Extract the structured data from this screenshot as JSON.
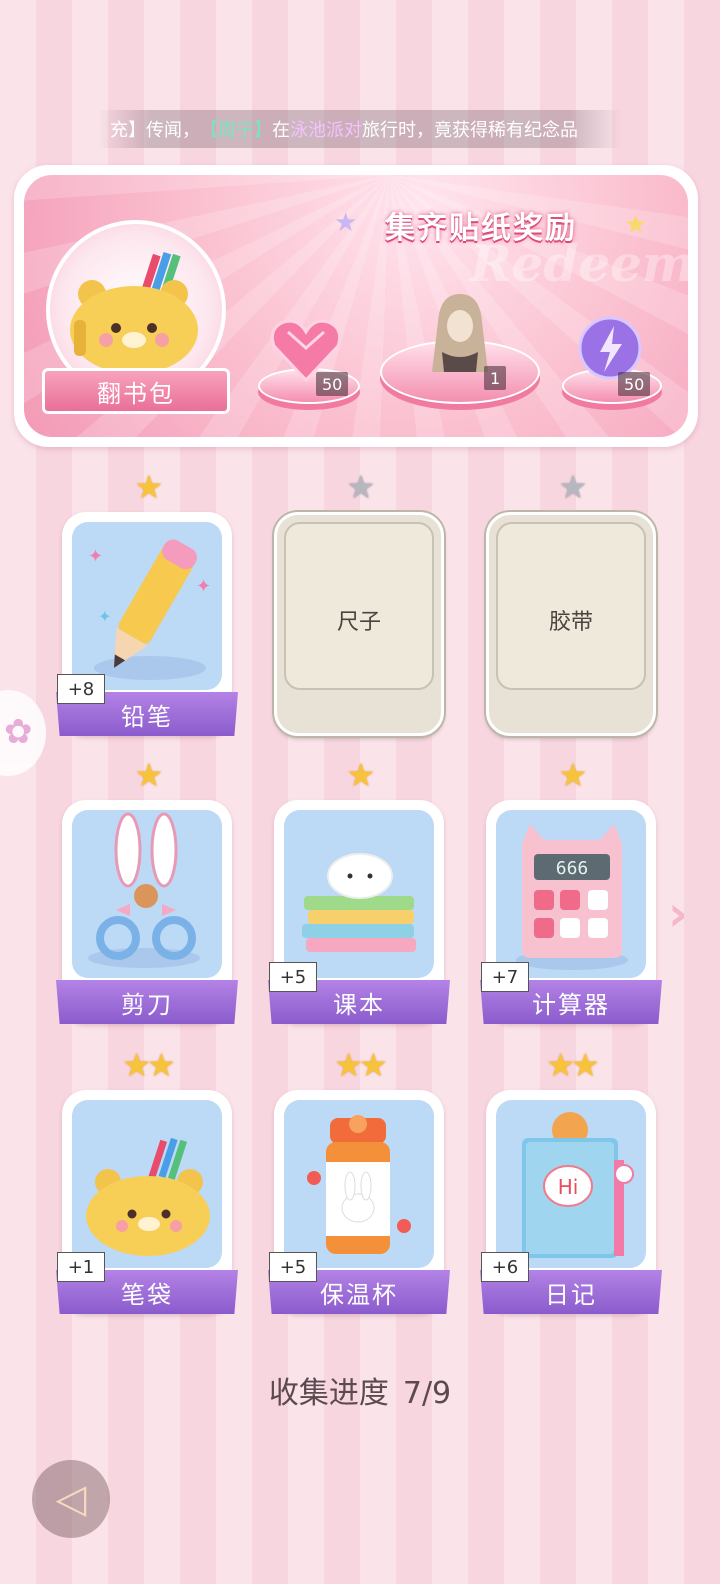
{
  "marquee": {
    "prefix": "充】传闻，",
    "player": "【周宁】",
    "mid": "在",
    "place": "泳池派对",
    "suffix": "旅行时，竟获得稀有纪念品"
  },
  "reward_panel": {
    "title": "集齐贴纸奖励",
    "watermark": "Redeem",
    "bag_label": "翻书包",
    "rewards": [
      {
        "icon": "pink-heart-gem-icon",
        "qty": "50"
      },
      {
        "icon": "doll-outfit-icon",
        "qty": "1"
      },
      {
        "icon": "lightning-orb-icon",
        "qty": "50"
      }
    ]
  },
  "cards": [
    {
      "name": "铅笔",
      "stars": 1,
      "collected": true,
      "bonus": "+8",
      "icon": "pencil-icon"
    },
    {
      "name": "尺子",
      "stars": 1,
      "collected": false,
      "icon": "ruler-icon"
    },
    {
      "name": "胶带",
      "stars": 1,
      "collected": false,
      "icon": "tape-icon"
    },
    {
      "name": "剪刀",
      "stars": 1,
      "collected": true,
      "icon": "bunny-scissors-icon"
    },
    {
      "name": "课本",
      "stars": 1,
      "collected": true,
      "bonus": "+5",
      "icon": "books-icon"
    },
    {
      "name": "计算器",
      "stars": 1,
      "collected": true,
      "bonus": "+7",
      "icon": "cat-calculator-icon",
      "display": "666"
    },
    {
      "name": "笔袋",
      "stars": 2,
      "collected": true,
      "bonus": "+1",
      "icon": "bear-pencil-case-icon"
    },
    {
      "name": "保温杯",
      "stars": 2,
      "collected": true,
      "bonus": "+5",
      "icon": "thermos-icon"
    },
    {
      "name": "日记",
      "stars": 2,
      "collected": true,
      "bonus": "+6",
      "icon": "diary-icon",
      "cover_text": "Hi"
    }
  ],
  "progress": {
    "label": "收集进度",
    "value": "7/9"
  }
}
